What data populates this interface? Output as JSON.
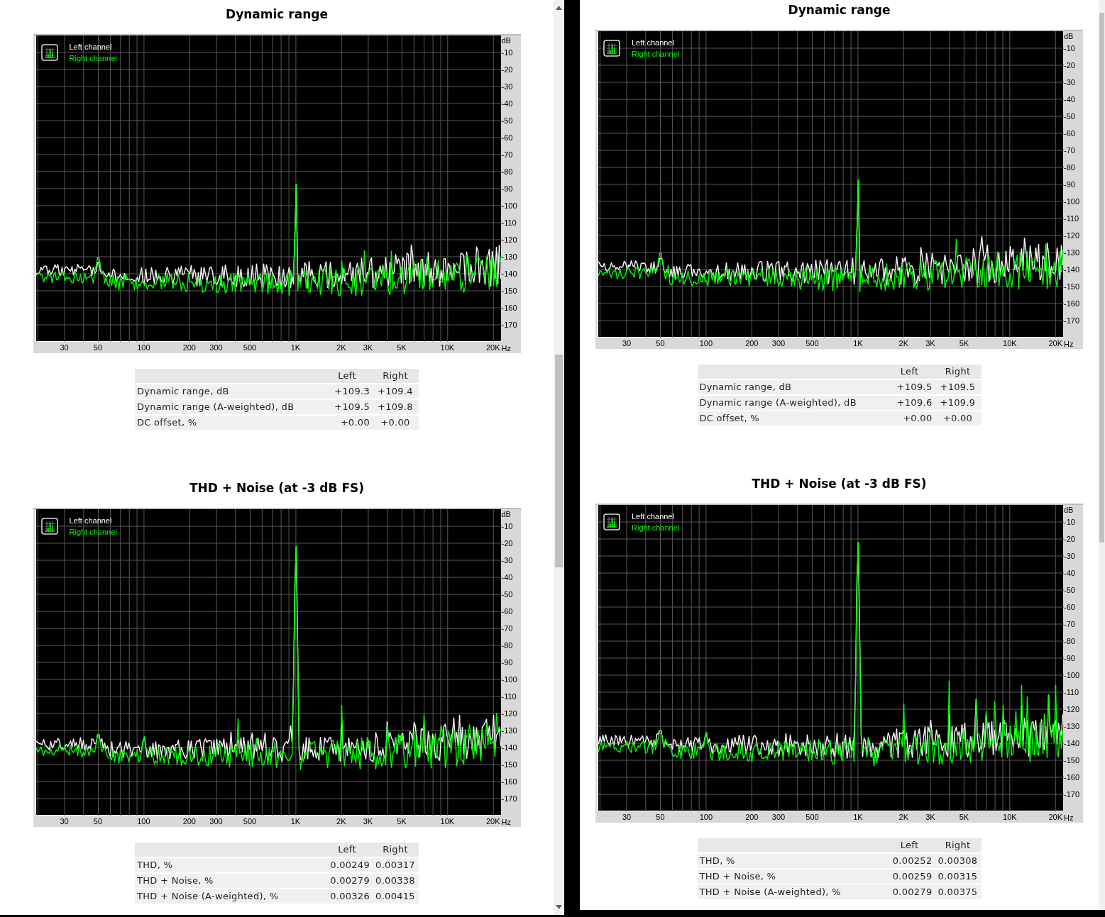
{
  "panes": [
    {
      "sections": [
        {
          "title": "Dynamic range",
          "chart": {
            "kind": "dynamic",
            "legend": [
              {
                "label": "Left channel",
                "color": "#ffffff"
              },
              {
                "label": "Right channel",
                "color": "#00ff00"
              }
            ],
            "y_ticks": [
              "dB",
              "-10",
              "-20",
              "-30",
              "-40",
              "-50",
              "-60",
              "-70",
              "-80",
              "-90",
              "-100",
              "-110",
              "-120",
              "-130",
              "-140",
              "-150",
              "-160",
              "-170"
            ],
            "x_ticks": [
              "30",
              "50",
              "100",
              "200",
              "300",
              "500",
              "1K",
              "2K",
              "3K",
              "5K",
              "10K",
              "20K"
            ],
            "x_unit": "Hz"
          },
          "table": {
            "columns": [
              "",
              "Left",
              "Right"
            ],
            "rows": [
              [
                "Dynamic range, dB",
                "+109.3",
                "+109.4"
              ],
              [
                "Dynamic range (A-weighted), dB",
                "+109.5",
                "+109.8"
              ],
              [
                "DC offset, %",
                "+0.00",
                "+0.00"
              ]
            ]
          }
        },
        {
          "title": "THD + Noise (at -3 dB FS)",
          "chart": {
            "kind": "thd",
            "legend": [
              {
                "label": "Left channel",
                "color": "#ffffff"
              },
              {
                "label": "Right channel",
                "color": "#00ff00"
              }
            ],
            "y_ticks": [
              "dB",
              "-10",
              "-20",
              "-30",
              "-40",
              "-50",
              "-60",
              "-70",
              "-80",
              "-90",
              "-100",
              "-110",
              "-120",
              "-130",
              "-140",
              "-150",
              "-160",
              "-170"
            ],
            "x_ticks": [
              "30",
              "50",
              "100",
              "200",
              "300",
              "500",
              "1K",
              "2K",
              "3K",
              "5K",
              "10K",
              "20K"
            ],
            "x_unit": "Hz"
          },
          "table": {
            "columns": [
              "",
              "Left",
              "Right"
            ],
            "rows": [
              [
                "THD, %",
                "0.00249",
                "0.00317"
              ],
              [
                "THD + Noise, %",
                "0.00279",
                "0.00338"
              ],
              [
                "THD + Noise (A-weighted), %",
                "0.00326",
                "0.00415"
              ]
            ]
          }
        }
      ]
    },
    {
      "sections": [
        {
          "title": "Dynamic range",
          "chart": {
            "kind": "dynamic",
            "legend": [
              {
                "label": "Left channel",
                "color": "#ffffff"
              },
              {
                "label": "Right channel",
                "color": "#00ff00"
              }
            ],
            "y_ticks": [
              "dB",
              "-10",
              "-20",
              "-30",
              "-40",
              "-50",
              "-60",
              "-70",
              "-80",
              "-90",
              "-100",
              "-110",
              "-120",
              "-130",
              "-140",
              "-150",
              "-160",
              "-170"
            ],
            "x_ticks": [
              "30",
              "50",
              "100",
              "200",
              "300",
              "500",
              "1K",
              "2K",
              "3K",
              "5K",
              "10K",
              "20K"
            ],
            "x_unit": "Hz"
          },
          "table": {
            "columns": [
              "",
              "Left",
              "Right"
            ],
            "rows": [
              [
                "Dynamic range, dB",
                "+109.5",
                "+109.5"
              ],
              [
                "Dynamic range (A-weighted), dB",
                "+109.6",
                "+109.9"
              ],
              [
                "DC offset, %",
                "+0.00",
                "+0.00"
              ]
            ]
          }
        },
        {
          "title": "THD + Noise (at -3 dB FS)",
          "chart": {
            "kind": "thd",
            "legend": [
              {
                "label": "Left channel",
                "color": "#ffffff"
              },
              {
                "label": "Right channel",
                "color": "#00ff00"
              }
            ],
            "y_ticks": [
              "dB",
              "-10",
              "-20",
              "-30",
              "-40",
              "-50",
              "-60",
              "-70",
              "-80",
              "-90",
              "-100",
              "-110",
              "-120",
              "-130",
              "-140",
              "-150",
              "-160",
              "-170"
            ],
            "x_ticks": [
              "30",
              "50",
              "100",
              "200",
              "300",
              "500",
              "1K",
              "2K",
              "3K",
              "5K",
              "10K",
              "20K"
            ],
            "x_unit": "Hz"
          },
          "table": {
            "columns": [
              "",
              "Left",
              "Right"
            ],
            "rows": [
              [
                "THD, %",
                "0.00252",
                "0.00308"
              ],
              [
                "THD + Noise, %",
                "0.00259",
                "0.00315"
              ],
              [
                "THD + Noise (A-weighted), %",
                "0.00279",
                "0.00375"
              ]
            ]
          }
        }
      ]
    }
  ]
}
